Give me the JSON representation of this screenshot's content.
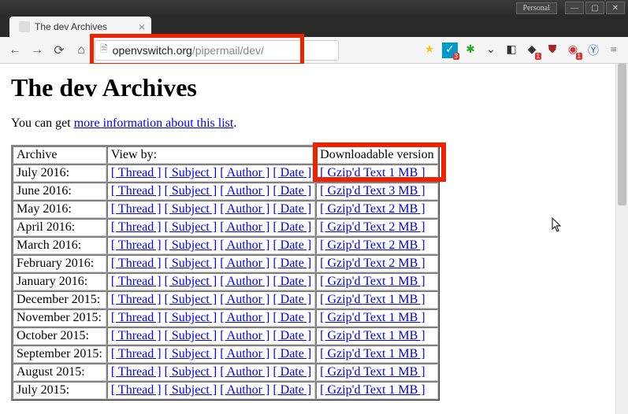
{
  "titlebar": {
    "personal": "Personal"
  },
  "tab": {
    "title": "The dev Archives"
  },
  "url": {
    "host": "openvswitch.org",
    "path": "/pipermail/dev/"
  },
  "ext_badges": {
    "b1": "3",
    "b2": "1",
    "b3": "1"
  },
  "page": {
    "heading": "The dev Archives",
    "intro_prefix": "You can get ",
    "intro_link": "more information about this list",
    "intro_suffix": "."
  },
  "table": {
    "headers": {
      "archive": "Archive",
      "viewby": "View by:",
      "download": "Downloadable version"
    },
    "linklabels": {
      "thread": "[ Thread ]",
      "subject": "[ Subject ]",
      "author": "[ Author ]",
      "date": "[ Date ]"
    },
    "rows": [
      {
        "archive": "July 2016:",
        "dl": "[ Gzip'd Text 1 MB ]"
      },
      {
        "archive": "June 2016:",
        "dl": "[ Gzip'd Text 3 MB ]"
      },
      {
        "archive": "May 2016:",
        "dl": "[ Gzip'd Text 2 MB ]"
      },
      {
        "archive": "April 2016:",
        "dl": "[ Gzip'd Text 2 MB ]"
      },
      {
        "archive": "March 2016:",
        "dl": "[ Gzip'd Text 2 MB ]"
      },
      {
        "archive": "February 2016:",
        "dl": "[ Gzip'd Text 2 MB ]"
      },
      {
        "archive": "January 2016:",
        "dl": "[ Gzip'd Text 1 MB ]"
      },
      {
        "archive": "December 2015:",
        "dl": "[ Gzip'd Text 1 MB ]"
      },
      {
        "archive": "November 2015:",
        "dl": "[ Gzip'd Text 1 MB ]"
      },
      {
        "archive": "October 2015:",
        "dl": "[ Gzip'd Text 1 MB ]"
      },
      {
        "archive": "September 2015:",
        "dl": "[ Gzip'd Text 1 MB ]"
      },
      {
        "archive": "August 2015:",
        "dl": "[ Gzip'd Text 1 MB ]"
      },
      {
        "archive": "July 2015:",
        "dl": "[ Gzip'd Text 1 MB ]"
      }
    ]
  }
}
